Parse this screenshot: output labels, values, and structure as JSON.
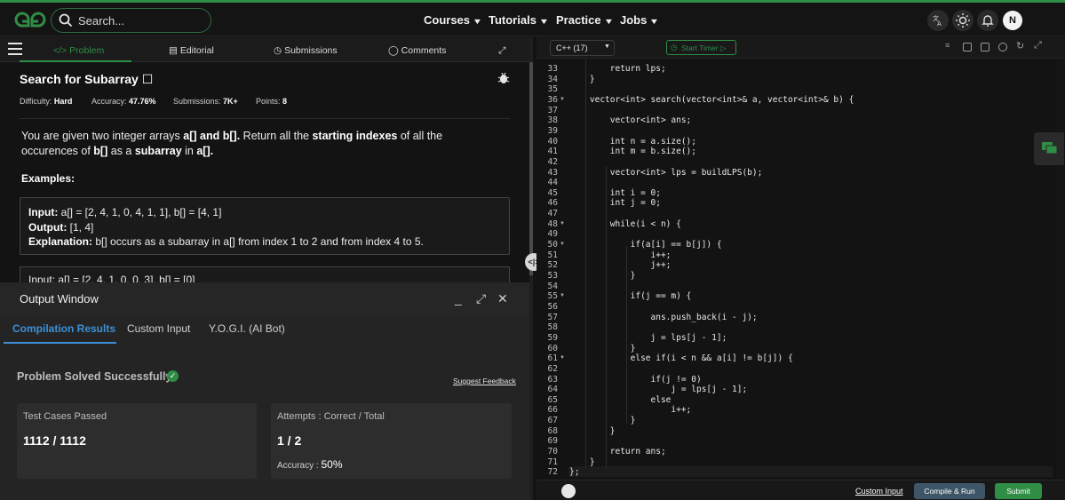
{
  "nav": {
    "search_placeholder": "Search...",
    "menus": [
      "Courses",
      "Tutorials",
      "Practice",
      "Jobs"
    ],
    "avatar_letter": "N"
  },
  "left_tabs": [
    "</> Problem",
    "Editorial",
    "Submissions",
    "Comments"
  ],
  "problem": {
    "title": "Search for Subarray",
    "difficulty_label": "Difficulty:",
    "difficulty": "Hard",
    "accuracy_label": "Accuracy:",
    "accuracy": "47.76%",
    "submissions_label": "Submissions:",
    "submissions": "7K+",
    "points_label": "Points:",
    "points": "8",
    "desc_1": "You are given two integer arrays ",
    "desc_2": "a[] and b[].",
    "desc_3": " Return all the ",
    "desc_4": "starting indexes",
    "desc_5": " of all the occurences of ",
    "desc_6": "b[]",
    "desc_7": " as a ",
    "desc_8": "subarray",
    "desc_9": " in ",
    "desc_10": "a[].",
    "examples_label": "Examples:",
    "ex1_input_label": "Input:",
    "ex1_input": " a[] = [2, 4, 1, 0, 4, 1, 1], b[] = [4, 1]",
    "ex1_output_label": "Output:",
    "ex1_output": " [1, 4]",
    "ex1_expl_label": "Explanation:",
    "ex1_expl": " b[] occurs as a subarray in a[] from index 1 to 2 and from index 4 to 5.",
    "ex2_partial": "Input: a[] = [2, 4, 1, 0, 0, 3], b[] = [0]"
  },
  "output": {
    "title": "Output Window",
    "tabs": [
      "Compilation Results",
      "Custom Input",
      "Y.O.G.I. (AI Bot)"
    ],
    "status": "Problem Solved Successfully",
    "suggest": "Suggest Feedback",
    "card1_label": "Test Cases Passed",
    "card1_value": "1112 / 1112",
    "card2_label": "Attempts : Correct / Total",
    "card2_value": "1 / 2",
    "accuracy_label": "Accuracy : ",
    "accuracy_value": "50%"
  },
  "editor": {
    "language": "C++ (17)",
    "timer": "Start Timer",
    "lines": [
      {
        "n": "33",
        "t": "        return lps;"
      },
      {
        "n": "34",
        "t": "    }"
      },
      {
        "n": "35",
        "t": ""
      },
      {
        "n": "36",
        "t": "    vector<int> search(vector<int>& a, vector<int>& b) {"
      },
      {
        "n": "37",
        "t": ""
      },
      {
        "n": "38",
        "t": "        vector<int> ans;"
      },
      {
        "n": "39",
        "t": ""
      },
      {
        "n": "40",
        "t": "        int n = a.size();"
      },
      {
        "n": "41",
        "t": "        int m = b.size();"
      },
      {
        "n": "42",
        "t": ""
      },
      {
        "n": "43",
        "t": "        vector<int> lps = buildLPS(b);"
      },
      {
        "n": "44",
        "t": ""
      },
      {
        "n": "45",
        "t": "        int i = 0;"
      },
      {
        "n": "46",
        "t": "        int j = 0;"
      },
      {
        "n": "47",
        "t": ""
      },
      {
        "n": "48",
        "t": "        while(i < n) {"
      },
      {
        "n": "49",
        "t": ""
      },
      {
        "n": "50",
        "t": "            if(a[i] == b[j]) {"
      },
      {
        "n": "51",
        "t": "                i++;"
      },
      {
        "n": "52",
        "t": "                j++;"
      },
      {
        "n": "53",
        "t": "            }"
      },
      {
        "n": "54",
        "t": ""
      },
      {
        "n": "55",
        "t": "            if(j == m) {"
      },
      {
        "n": "56",
        "t": ""
      },
      {
        "n": "57",
        "t": "                ans.push_back(i - j);"
      },
      {
        "n": "58",
        "t": ""
      },
      {
        "n": "59",
        "t": "                j = lps[j - 1];"
      },
      {
        "n": "60",
        "t": "            }"
      },
      {
        "n": "61",
        "t": "            else if(i < n && a[i] != b[j]) {"
      },
      {
        "n": "62",
        "t": ""
      },
      {
        "n": "63",
        "t": "                if(j != 0)"
      },
      {
        "n": "64",
        "t": "                    j = lps[j - 1];"
      },
      {
        "n": "65",
        "t": "                else"
      },
      {
        "n": "66",
        "t": "                    i++;"
      },
      {
        "n": "67",
        "t": "            }"
      },
      {
        "n": "68",
        "t": "        }"
      },
      {
        "n": "69",
        "t": ""
      },
      {
        "n": "70",
        "t": "        return ans;"
      },
      {
        "n": "71",
        "t": "    }"
      },
      {
        "n": "72",
        "t": "};"
      }
    ],
    "fold_lines": [
      "36",
      "48",
      "50",
      "55",
      "61"
    ]
  },
  "bottom": {
    "custom_input": "Custom Input",
    "compile": "Compile & Run",
    "submit": "Submit"
  },
  "colors": {
    "brand": "#2f8d46",
    "tab_blue": "#3c8fd6"
  }
}
